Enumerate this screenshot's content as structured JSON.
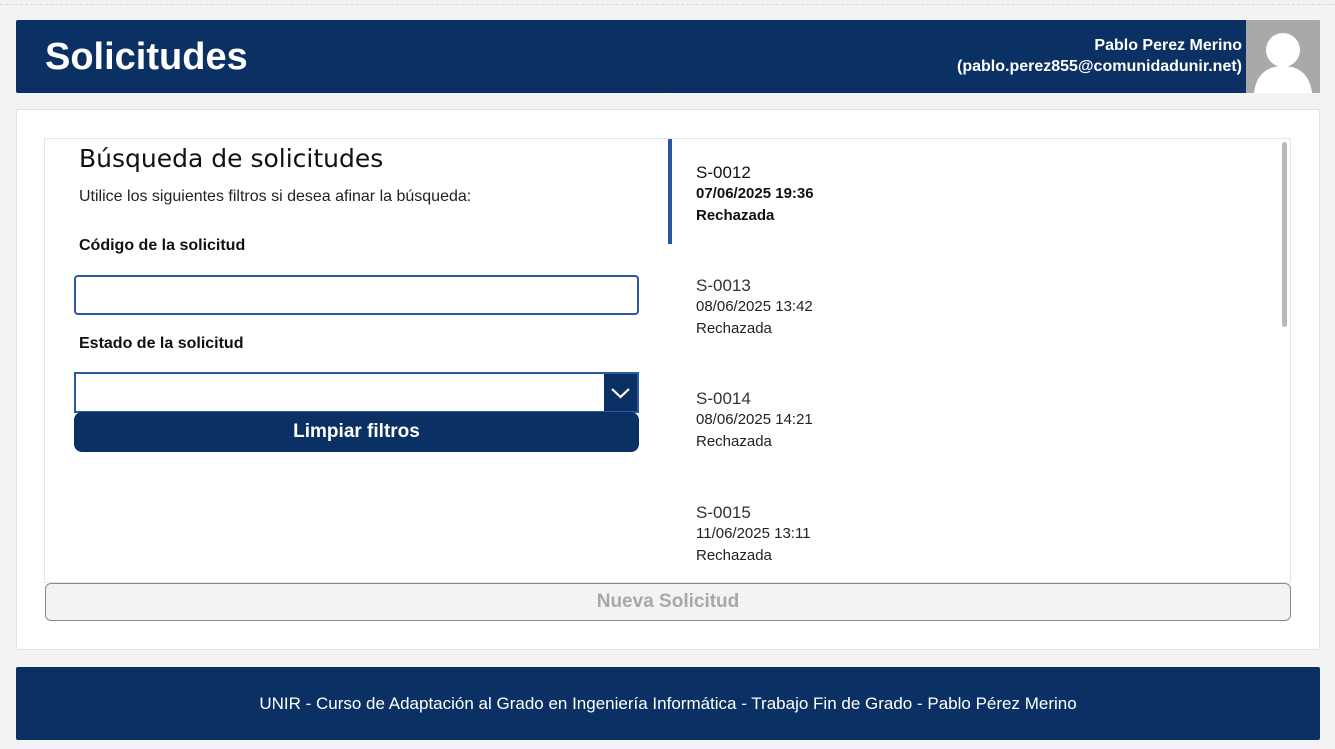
{
  "header": {
    "title": "Solicitudes",
    "user_name": "Pablo Perez Merino",
    "user_email": "(pablo.perez855@comunidadunir.net)"
  },
  "search": {
    "title": "Búsqueda de solicitudes",
    "subtitle": "Utilice los siguientes filtros si desea afinar la búsqueda:",
    "code_label": "Código de la solicitud",
    "code_value": "",
    "state_label": "Estado de la solicitud",
    "state_value": "",
    "clear_button": "Limpiar filtros"
  },
  "requests": [
    {
      "code": "S-0012",
      "date": "07/06/2025 19:36",
      "state": "Rechazada",
      "selected": true
    },
    {
      "code": "S-0013",
      "date": "08/06/2025 13:42",
      "state": "Rechazada",
      "selected": false
    },
    {
      "code": "S-0014",
      "date": "08/06/2025 14:21",
      "state": "Rechazada",
      "selected": false
    },
    {
      "code": "S-0015",
      "date": "11/06/2025 13:11",
      "state": "Rechazada",
      "selected": false
    }
  ],
  "new_request_button": "Nueva Solicitud",
  "footer": {
    "text": "UNIR - Curso de Adaptación al Grado en Ingeniería Informática - Trabajo Fin de Grado - Pablo Pérez Merino"
  },
  "colors": {
    "primary": "#0b3063",
    "accent": "#2a55a4",
    "avatar_bg": "#a9a9a9"
  },
  "icons": {
    "avatar": "user-avatar-icon",
    "dropdown": "chevron-down-icon"
  }
}
